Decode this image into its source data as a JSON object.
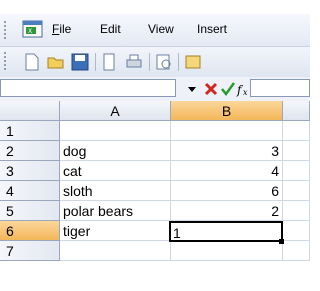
{
  "menu": {
    "items": [
      {
        "label": "File"
      },
      {
        "label": "Edit"
      },
      {
        "label": "View"
      },
      {
        "label": "Insert"
      }
    ]
  },
  "formula_bar": {
    "namebox_value": "",
    "formula_value": ""
  },
  "grid": {
    "columns": [
      "A",
      "B"
    ],
    "rows": [
      {
        "num": "1",
        "a": "",
        "b": ""
      },
      {
        "num": "2",
        "a": "dog",
        "b": "3"
      },
      {
        "num": "3",
        "a": "cat",
        "b": "4"
      },
      {
        "num": "4",
        "a": "sloth",
        "b": "6"
      },
      {
        "num": "5",
        "a": "polar bears",
        "b": "2"
      },
      {
        "num": "6",
        "a": "tiger",
        "b": "1"
      },
      {
        "num": "7",
        "a": "",
        "b": ""
      }
    ],
    "active_cell": "B6"
  },
  "colors": {
    "active_header": "#f4b65a",
    "gridline": "#d0d7e5",
    "cancel_red": "#d0281e",
    "enter_green": "#2a9a2a"
  }
}
